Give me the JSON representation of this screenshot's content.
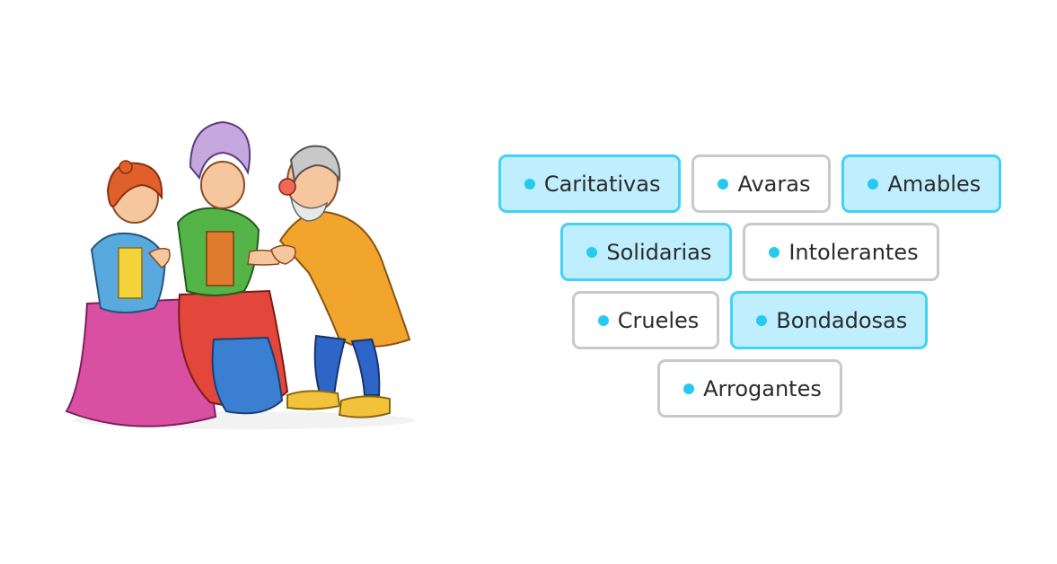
{
  "illustration": {
    "icon": "family-illustration-icon"
  },
  "colors": {
    "selected_bg": "#bfefff",
    "selected_border": "#43d2f3",
    "default_border": "#c9c9c9",
    "dot": "#28c8ef"
  },
  "options": {
    "rows": [
      [
        {
          "label": "Caritativas",
          "selected": true
        },
        {
          "label": "Avaras",
          "selected": false
        },
        {
          "label": "Amables",
          "selected": true
        }
      ],
      [
        {
          "label": "Solidarias",
          "selected": true
        },
        {
          "label": "Intolerantes",
          "selected": false
        }
      ],
      [
        {
          "label": "Crueles",
          "selected": false
        },
        {
          "label": "Bondadosas",
          "selected": true
        }
      ],
      [
        {
          "label": "Arrogantes",
          "selected": false
        }
      ]
    ]
  }
}
